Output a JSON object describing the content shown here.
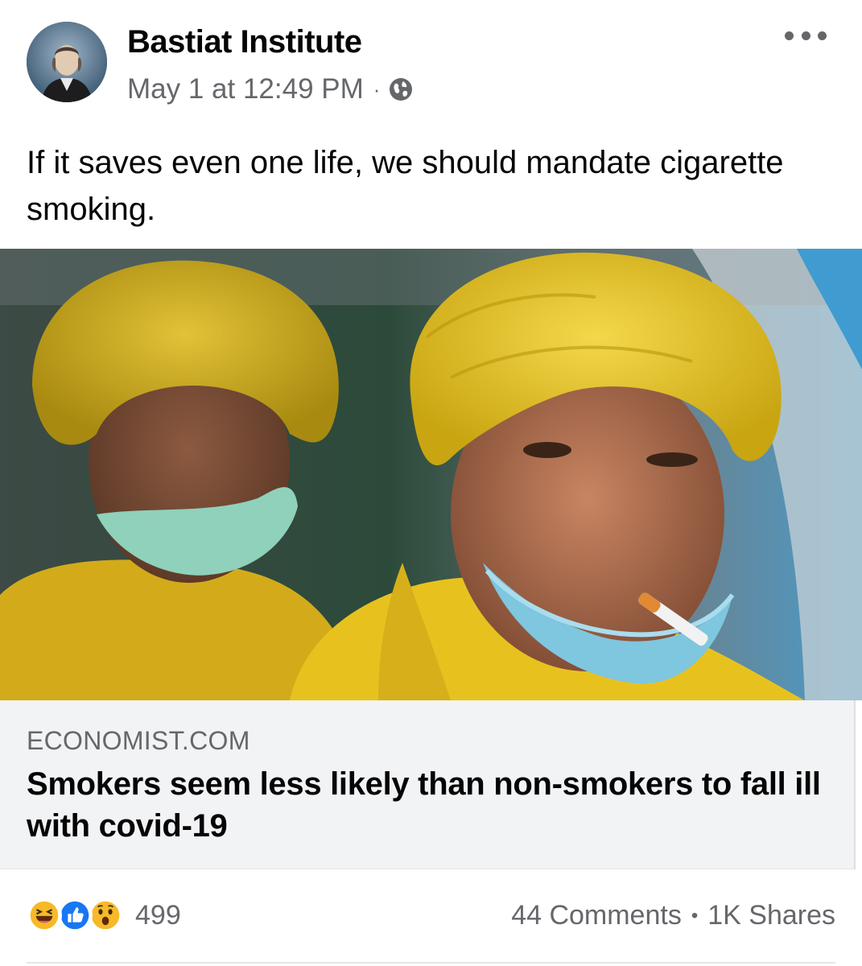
{
  "post": {
    "author": "Bastiat Institute",
    "timestamp": "May 1 at 12:49 PM",
    "meta_separator": "·",
    "privacy_icon": "globe-icon",
    "more_icon": "more-options-icon",
    "text": "If it saves even one life, we should mandate cigarette smoking."
  },
  "link": {
    "domain": "ECONOMIST.COM",
    "title": "Smokers seem less likely than non-smokers to fall ill with covid-19",
    "image_description_icon": "link-preview-photo"
  },
  "engagement": {
    "reactions": [
      "haha-reaction-icon",
      "like-reaction-icon",
      "wow-reaction-icon"
    ],
    "reaction_count": "499",
    "comments": "44 Comments",
    "separator": "•",
    "shares": "1K Shares"
  },
  "colors": {
    "secondary_text": "#65676b",
    "primary_text": "#050505",
    "preview_bg": "#f2f3f5",
    "like_blue": "#1877f2",
    "reaction_yellow": "#f7b928"
  }
}
